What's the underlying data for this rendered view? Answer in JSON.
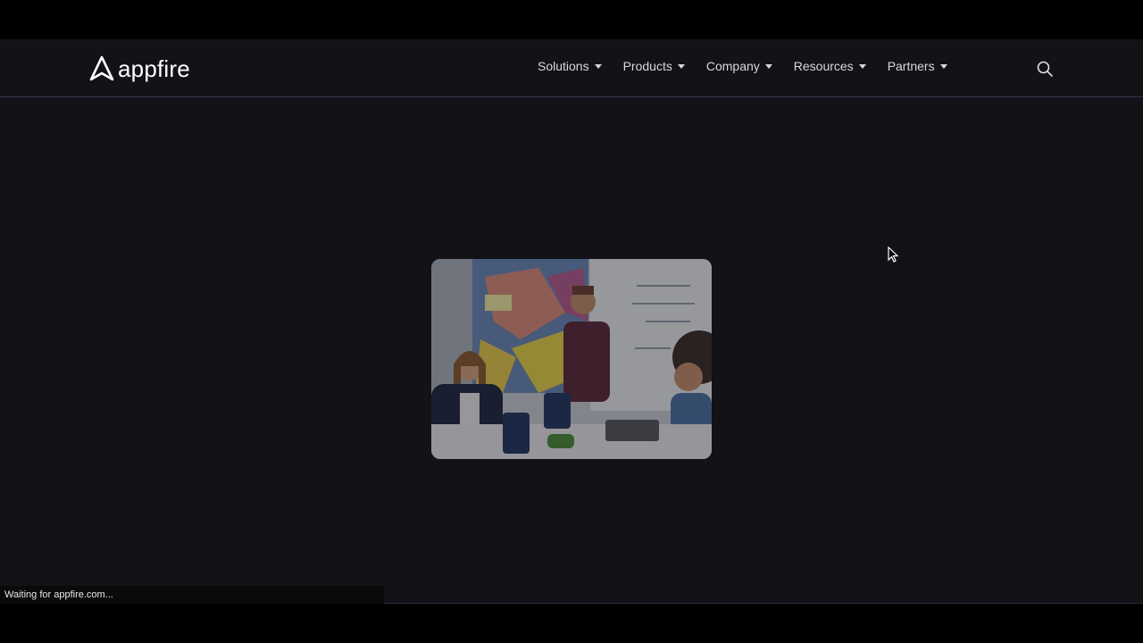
{
  "brand": {
    "name": "appfire",
    "logo_icon": "appfire-logo-icon",
    "text_color": "#ffffff"
  },
  "nav": {
    "items": [
      {
        "label": "Solutions"
      },
      {
        "label": "Products"
      },
      {
        "label": "Company"
      },
      {
        "label": "Resources"
      },
      {
        "label": "Partners"
      }
    ],
    "search_icon": "search-icon"
  },
  "hero": {
    "image_subject": "team-meeting-photo"
  },
  "status_bar": {
    "text": "Waiting for appfire.com..."
  },
  "colors": {
    "background": "#121217",
    "header_border": "#34344e",
    "nav_text": "#d8d8e0"
  }
}
